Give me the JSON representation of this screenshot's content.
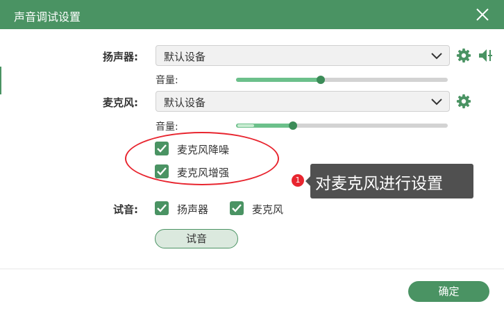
{
  "window": {
    "title": "声音调试设置"
  },
  "speaker": {
    "label": "扬声器:",
    "device": "默认设备",
    "volume_label": "音量:",
    "volume": 0.4
  },
  "microphone": {
    "label": "麦克风:",
    "device": "默认设备",
    "volume_label": "音量:",
    "volume": 0.27,
    "input_level": 0.08
  },
  "options": [
    {
      "label": "麦克风降噪",
      "checked": true
    },
    {
      "label": "麦克风增强",
      "checked": true
    }
  ],
  "test": {
    "label": "试音:",
    "checks": [
      {
        "label": "扬声器",
        "checked": true
      },
      {
        "label": "麦克风",
        "checked": true
      }
    ],
    "button": "试音"
  },
  "annotation": {
    "badge": "1",
    "text": "对麦克风进行设置"
  },
  "footer": {
    "ok": "确定"
  },
  "colors": {
    "accent": "#4a9363",
    "slider_fill": "#6cc08b",
    "highlight": "#e8252f"
  }
}
